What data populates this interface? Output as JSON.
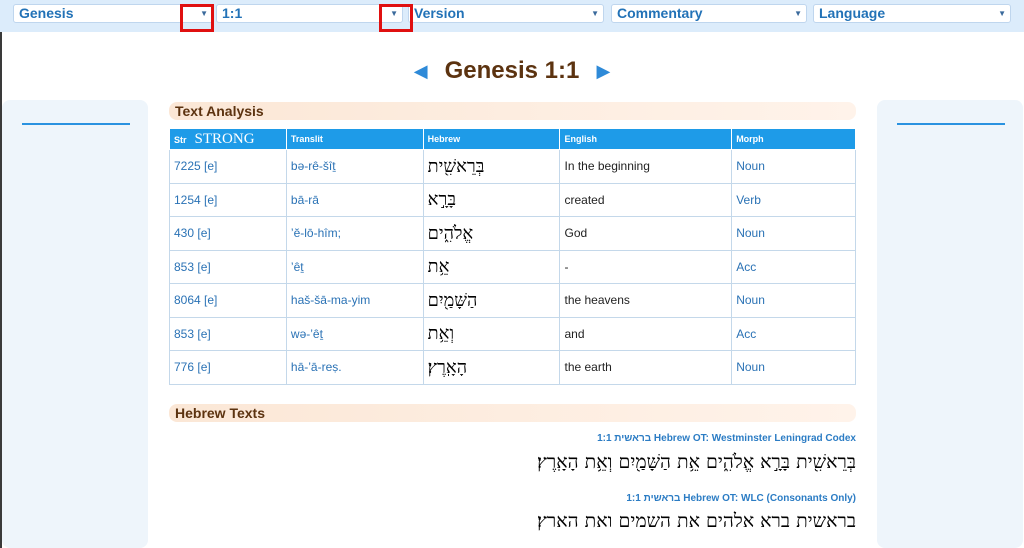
{
  "toolbar": {
    "book": "Genesis",
    "verse": "1:1",
    "version": "Version",
    "commentary": "Commentary",
    "language": "Language",
    "arrow": "▼"
  },
  "title": {
    "prev": "◀",
    "text": "Genesis 1:1",
    "next": "▶"
  },
  "analysis": {
    "heading": "Text Analysis",
    "columns": [
      "Str",
      "STRONG",
      "Translit",
      "Hebrew",
      "English",
      "Morph"
    ],
    "rows": [
      {
        "str": "7225 [e]",
        "translit": "bə-rê-šîṯ",
        "hebrew": "בְּרֵאשִׁ֖ית",
        "english": "In the beginning",
        "morph": "Noun"
      },
      {
        "str": "1254 [e]",
        "translit": "bā-rā",
        "hebrew": "בָּרָ֣א",
        "english": "created",
        "morph": "Verb"
      },
      {
        "str": "430 [e]",
        "translit": "’ĕ-lō-hîm;",
        "hebrew": "אֱלֹהִ֑ים",
        "english": "God",
        "morph": "Noun"
      },
      {
        "str": "853 [e]",
        "translit": "’êṯ",
        "hebrew": "אֵ֥ת",
        "english": "-",
        "morph": "Acc"
      },
      {
        "str": "8064 [e]",
        "translit": "haš-šā-ma-yim",
        "hebrew": "הַשָּׁמַ֖יִם",
        "english": "the heavens",
        "morph": "Noun"
      },
      {
        "str": "853 [e]",
        "translit": "wə-’êṯ",
        "hebrew": "וְאֵ֥ת",
        "english": "and",
        "morph": "Acc"
      },
      {
        "str": "776 [e]",
        "translit": "hā-’ā-reṣ.",
        "hebrew": "הָאָֽרֶץ׃",
        "english": "the earth",
        "morph": "Noun"
      }
    ]
  },
  "hebrew_texts": {
    "heading": "Hebrew Texts",
    "sources": [
      {
        "label": "בראשית 1:1 Hebrew OT: Westminster Leningrad Codex",
        "text": "בְּרֵאשִׁ֖ית בָּרָ֣א אֱלֹהִ֑ים אֵ֥ת הַשָּׁמַ֖יִם וְאֵ֥ת הָאָֽרֶץ׃"
      },
      {
        "label": "בראשית 1:1 Hebrew OT: WLC (Consonants Only)",
        "text": "בראשית ברא אלהים את השמים ואת הארץ׃"
      }
    ]
  },
  "colors": {
    "accent": "#1e9be8",
    "title": "#5c3310",
    "highlight": "#e01010"
  }
}
